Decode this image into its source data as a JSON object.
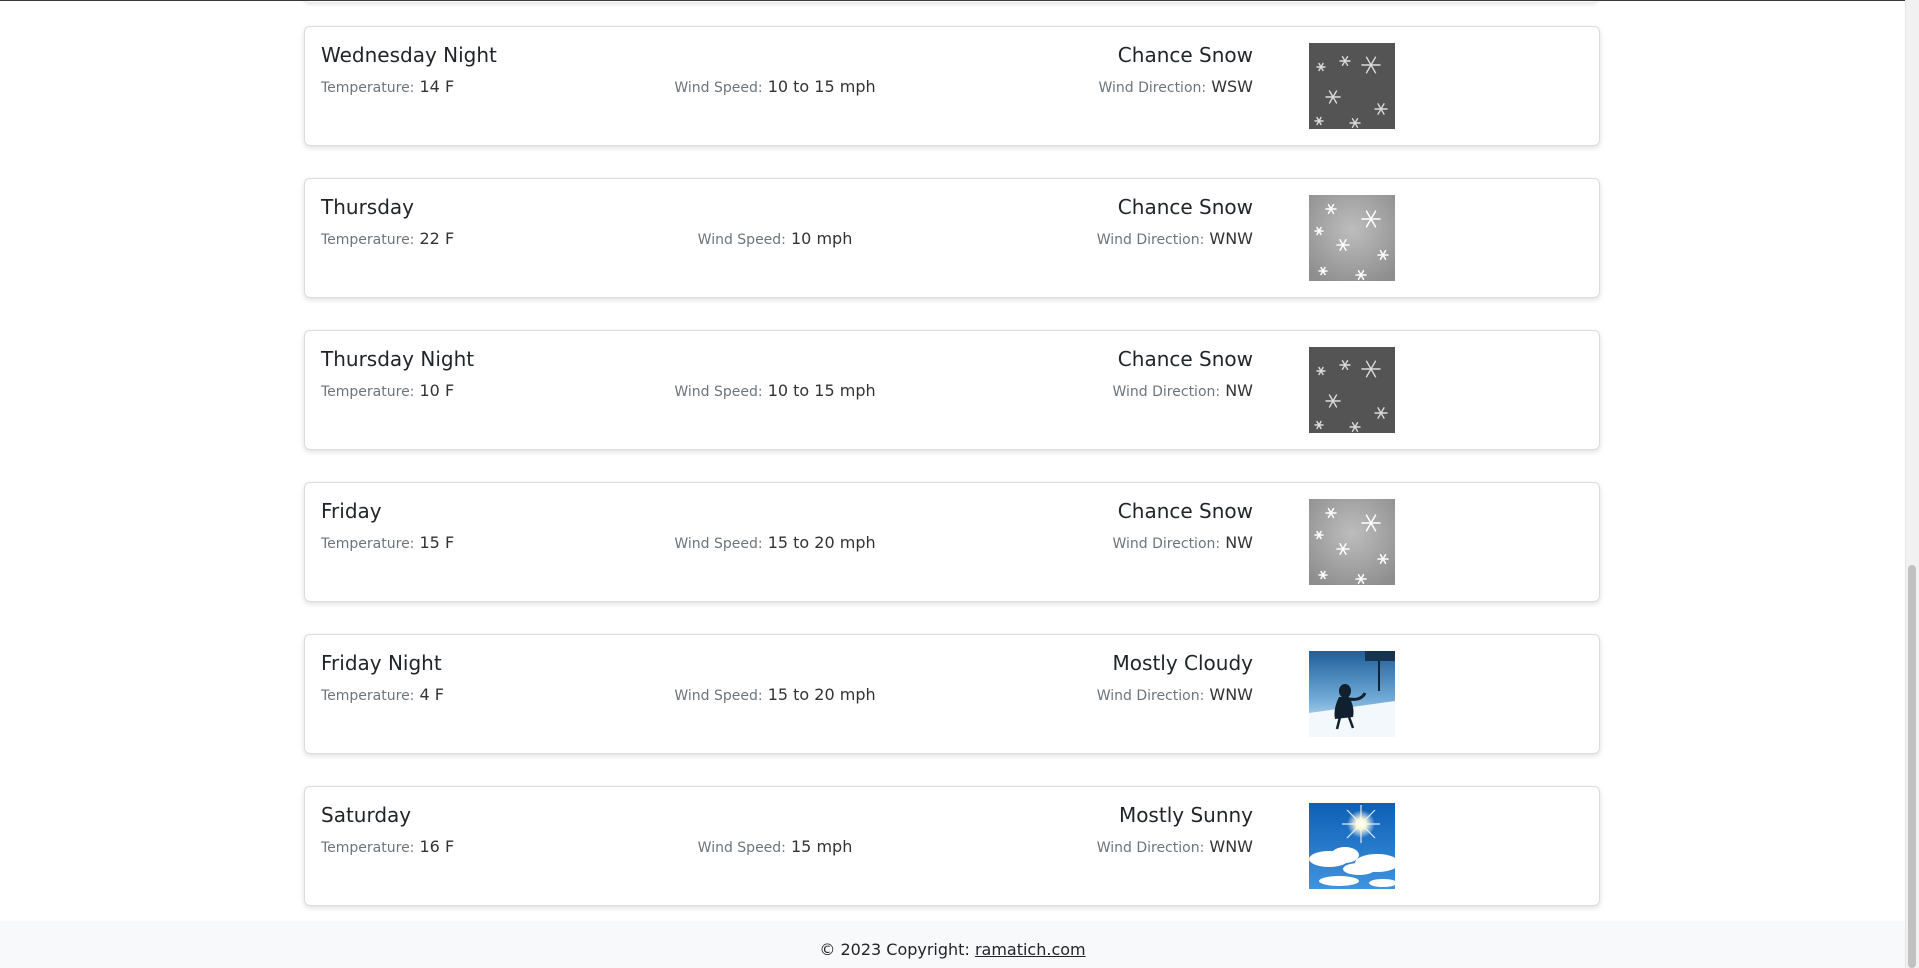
{
  "forecast": {
    "temperature_label": "Temperature:",
    "wind_speed_label": "Wind Speed:",
    "wind_direction_label": "Wind Direction:",
    "periods": [
      {
        "name": "Wednesday Night",
        "temperature": "14 F",
        "wind_speed": "10 to 15 mph",
        "short_forecast": "Chance Snow",
        "wind_direction": "WSW",
        "icon": "snow-night-icon"
      },
      {
        "name": "Thursday",
        "temperature": "22 F",
        "wind_speed": "10 mph",
        "short_forecast": "Chance Snow",
        "wind_direction": "WNW",
        "icon": "snow-day-icon"
      },
      {
        "name": "Thursday Night",
        "temperature": "10 F",
        "wind_speed": "10 to 15 mph",
        "short_forecast": "Chance Snow",
        "wind_direction": "NW",
        "icon": "snow-night-icon"
      },
      {
        "name": "Friday",
        "temperature": "15 F",
        "wind_speed": "15 to 20 mph",
        "short_forecast": "Chance Snow",
        "wind_direction": "NW",
        "icon": "snow-day-icon"
      },
      {
        "name": "Friday Night",
        "temperature": "4 F",
        "wind_speed": "15 to 20 mph",
        "short_forecast": "Mostly Cloudy",
        "wind_direction": "WNW",
        "icon": "cold-windy-icon"
      },
      {
        "name": "Saturday",
        "temperature": "16 F",
        "wind_speed": "15 mph",
        "short_forecast": "Mostly Sunny",
        "wind_direction": "WNW",
        "icon": "sunny-sky-icon"
      }
    ]
  },
  "footer": {
    "copyright": "© 2023 Copyright:",
    "link_text": "ramatich.com"
  }
}
